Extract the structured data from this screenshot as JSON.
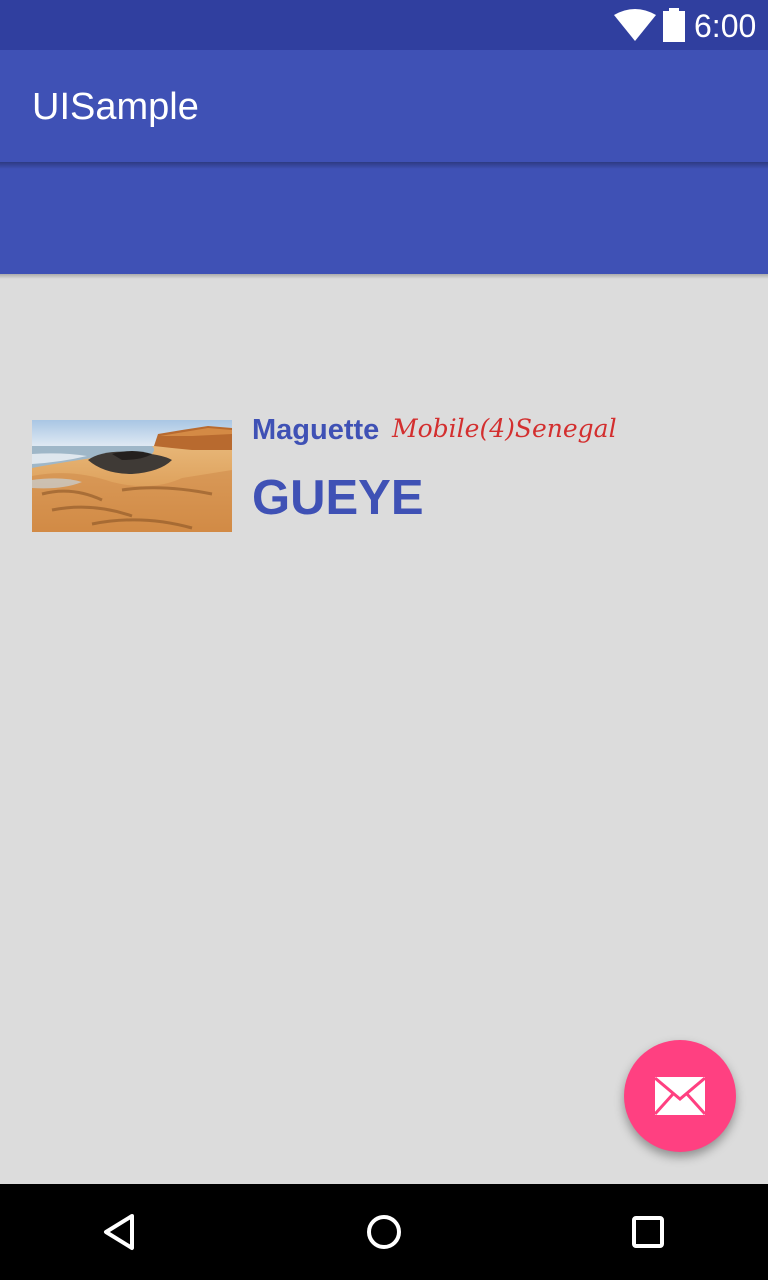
{
  "status_bar": {
    "time": "6:00",
    "icons": [
      "wifi-icon",
      "battery-icon"
    ]
  },
  "app_bar": {
    "title": "UISample"
  },
  "profile": {
    "image": "beach-photo",
    "first_name": "Maguette",
    "tagline": "Mobile(4)Senegal",
    "last_name": "GUEYE"
  },
  "fab": {
    "icon": "mail-icon"
  },
  "nav_bar": {
    "buttons": [
      "back-icon",
      "home-icon",
      "recents-icon"
    ]
  },
  "colors": {
    "primary": "#3f51b5",
    "primary_dark": "#303f9f",
    "accent": "#ff4081",
    "tagline": "#d32f2f",
    "background": "#dcdcdc"
  }
}
